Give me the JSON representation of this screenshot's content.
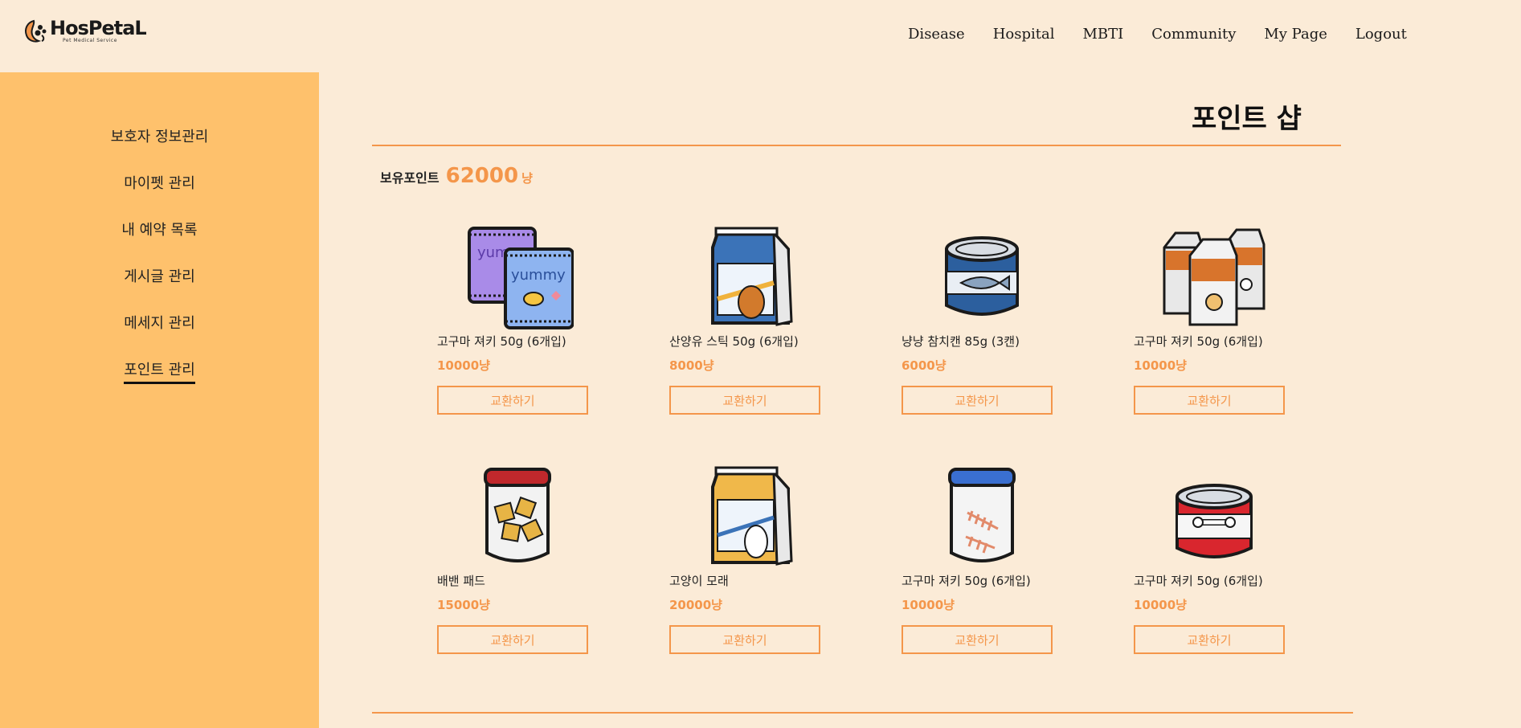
{
  "app": {
    "name": "HosPetaL",
    "subtitle": "Pet Medical Service"
  },
  "nav": [
    "Disease",
    "Hospital",
    "MBTI",
    "Community",
    "My Page",
    "Logout"
  ],
  "sidebar": {
    "items": [
      {
        "label": "보호자 정보관리"
      },
      {
        "label": "마이펫 관리"
      },
      {
        "label": "내 예약 목록"
      },
      {
        "label": "게시글 관리"
      },
      {
        "label": "메세지 관리"
      },
      {
        "label": "포인트 관리"
      }
    ]
  },
  "page": {
    "title": "포인트 샵"
  },
  "points": {
    "label": "보유포인트",
    "value": "62000",
    "unit": "냥"
  },
  "products": [
    {
      "name": "고구마 져키 50g (6개입)",
      "price": "10000냥",
      "button": "교환하기",
      "icon": "jerky-bag-icon"
    },
    {
      "name": "산양유 스틱 50g (6개입)",
      "price": "8000냥",
      "button": "교환하기",
      "icon": "dog-food-bag-icon"
    },
    {
      "name": "냥냥 참치캔 85g (3캔)",
      "price": "6000냥",
      "button": "교환하기",
      "icon": "tuna-can-icon"
    },
    {
      "name": "고구마 져키 50g (6개입)",
      "price": "10000냥",
      "button": "교환하기",
      "icon": "milk-cartons-icon"
    },
    {
      "name": "배밴 패드",
      "price": "15000냥",
      "button": "교환하기",
      "icon": "treat-jar-icon"
    },
    {
      "name": "고양이 모래",
      "price": "20000냥",
      "button": "교환하기",
      "icon": "cat-litter-bag-icon"
    },
    {
      "name": "고구마 져키 50g (6개입)",
      "price": "10000냥",
      "button": "교환하기",
      "icon": "fish-bone-jar-icon"
    },
    {
      "name": "고구마 져키 50g (6개입)",
      "price": "10000냥",
      "button": "교환하기",
      "icon": "bone-can-icon"
    }
  ],
  "colors": {
    "background": "#fbebd7",
    "sidebar": "#fec16c",
    "accent": "#f4964a"
  }
}
